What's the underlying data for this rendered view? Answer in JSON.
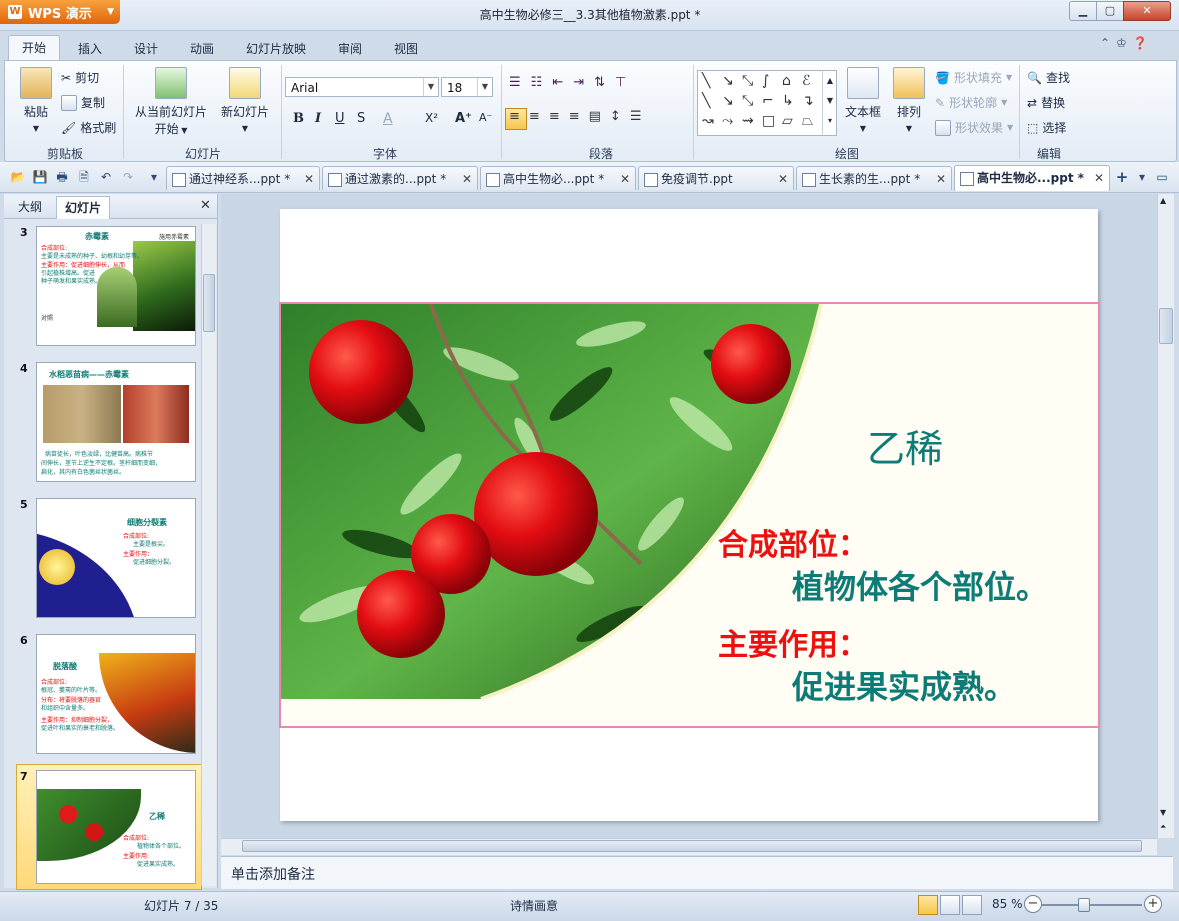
{
  "app": {
    "brand": "WPS 演示",
    "window_title": "高中生物必修三__3.3其他植物激素.ppt *"
  },
  "ribbon_tabs": [
    "开始",
    "插入",
    "设计",
    "动画",
    "幻灯片放映",
    "审阅",
    "视图"
  ],
  "ribbon": {
    "clipboard": {
      "paste": "粘贴",
      "cut": "剪切",
      "copy": "复制",
      "format_painter": "格式刷",
      "label": "剪贴板"
    },
    "slides": {
      "from_current": "从当前幻灯片",
      "from_current_2": "开始",
      "new_slide": "新幻灯片",
      "label": "幻灯片"
    },
    "font": {
      "family": "Arial",
      "size": "18",
      "label": "字体",
      "bold": "B",
      "italic": "I",
      "underline": "U",
      "strike": "S",
      "color": "A",
      "superscript": "X²",
      "grow": "A⁺",
      "shrink": "A⁻"
    },
    "paragraph": {
      "label": "段落"
    },
    "drawing": {
      "textbox": "文本框",
      "arrange": "排列",
      "shape_fill": "形状填充",
      "shape_outline": "形状轮廓",
      "shape_effect": "形状效果",
      "label": "绘图"
    },
    "edit": {
      "find": "查找",
      "replace": "替换",
      "select": "选择",
      "label": "编辑"
    }
  },
  "doc_tabs": [
    {
      "label": "通过神经系...ppt *",
      "active": false
    },
    {
      "label": "通过激素的...ppt *",
      "active": false
    },
    {
      "label": "高中生物必...ppt *",
      "active": false
    },
    {
      "label": "免疫调节.ppt",
      "active": false
    },
    {
      "label": "生长素的生...ppt *",
      "active": false
    },
    {
      "label": "高中生物必...ppt *",
      "active": true
    }
  ],
  "left_pane": {
    "tabs": [
      "大纲",
      "幻灯片"
    ],
    "thumbnails": [
      {
        "num": "3",
        "title": "赤霉素",
        "corner": "施用赤霉素",
        "lines": [
          "合成部位:",
          "主要是未成熟的种子、幼根和幼芽等。",
          "主要作用：促进细胞伸长，从而",
          "引起植株增高。促进",
          "种子萌发和果实成熟。"
        ],
        "foot": "对照"
      },
      {
        "num": "4",
        "title": "水稻恶苗病——赤霉素",
        "lines": [
          "病苗徒长，叶色淡绿，比健苗高。病株节",
          "间伸长，茎节上逆生不定根。茎杆细而变细，",
          "扁化，其内有白色菌丝状菌丝。"
        ]
      },
      {
        "num": "5",
        "title": "细胞分裂素",
        "lines": [
          "合成部位:",
          "主要是根尖。",
          "主要作用：",
          "促进细胞分裂。"
        ]
      },
      {
        "num": "6",
        "title": "脱落酸",
        "lines": [
          "合成部位:",
          "根冠、萎蔫的叶片等。",
          "分布：将要脱落的器官",
          "和组织中含量多。",
          "主要作用：抑制细胞分裂，",
          "促进叶和果实的衰老和脱落。"
        ]
      },
      {
        "num": "7",
        "title": "乙稀",
        "lines": [
          "合成部位:",
          "植物体各个部位。",
          "主要作用:",
          "促进果实成熟。"
        ]
      }
    ]
  },
  "slide": {
    "title": "乙稀",
    "synthesis_label": "合成部位：",
    "synthesis_value": "植物体各个部位。",
    "function_label": "主要作用：",
    "function_value": "促进果实成熟。"
  },
  "notes_placeholder": "单击添加备注",
  "status": {
    "slide_info": "幻灯片 7 / 35",
    "theme": "诗情画意",
    "zoom": "85 %"
  },
  "colors": {
    "teal": "#0d7b76",
    "red": "#ee0f0f",
    "frame_pink": "#e889b3"
  }
}
